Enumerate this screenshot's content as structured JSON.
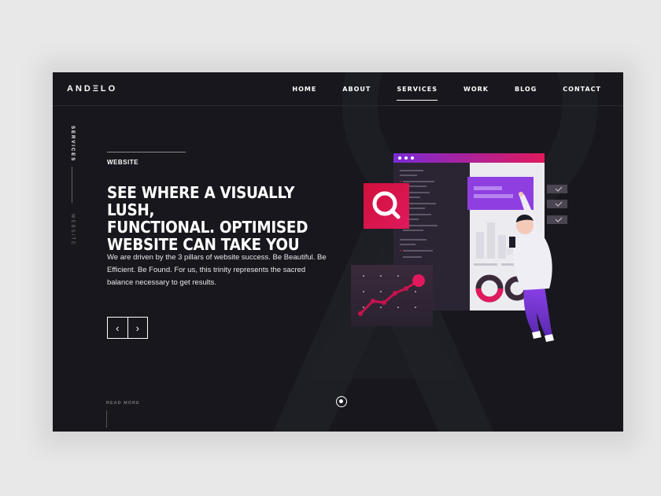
{
  "brand": {
    "logo": "ANDΞLO"
  },
  "nav": {
    "items": [
      {
        "label": "HOME"
      },
      {
        "label": "ABOUT"
      },
      {
        "label": "SERVICES",
        "active": true
      },
      {
        "label": "WORK"
      },
      {
        "label": "BLOG"
      },
      {
        "label": "CONTACT"
      }
    ]
  },
  "side": {
    "section": "SERVICES",
    "subsection": "WEBSITE"
  },
  "hero": {
    "eyebrow": "WEBSITE",
    "headline_line1": "SEE WHERE A VISUALLY LUSH,",
    "headline_line2": "FUNCTIONAL. OPTIMISED",
    "headline_line3": "WEBSITE CAN TAKE YOU",
    "description": "We are driven by the 3 pillars of website success. Be Beautiful. Be Efficient. Be Found. For us, this trinity represents the sacred balance necessary to get results.",
    "prev_arrow": "‹",
    "next_arrow": "›",
    "read_more": "READ MORE"
  },
  "icons": {
    "search": "search-icon",
    "prev": "chevron-left-icon",
    "next": "chevron-right-icon"
  },
  "colors": {
    "background": "#17171d",
    "accent_pink": "#e0195c",
    "accent_purple": "#8f3fe0",
    "accent_red": "#d01040"
  }
}
